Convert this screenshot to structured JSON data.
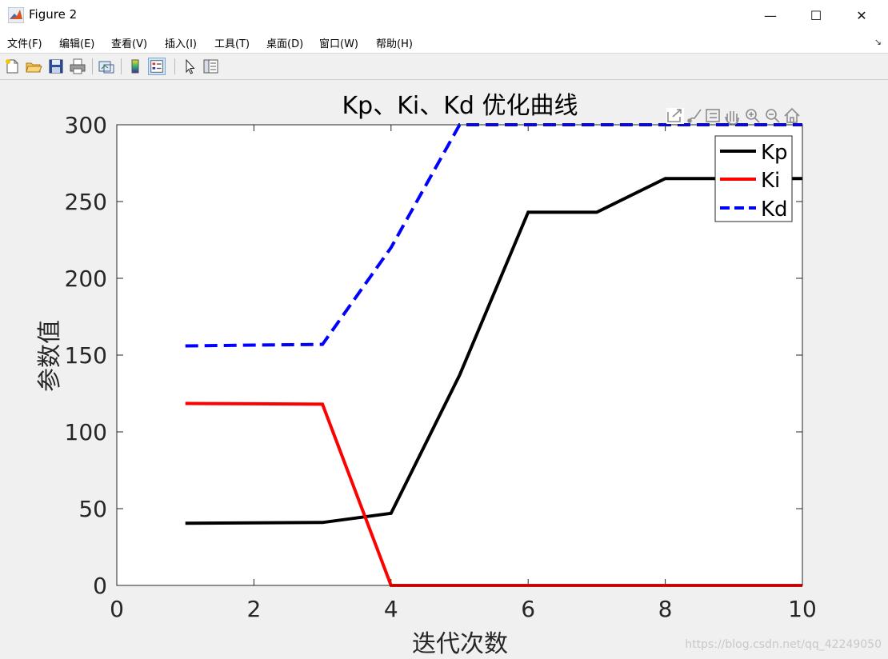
{
  "window": {
    "title": "Figure 2"
  },
  "window_controls": {
    "minimize": "—",
    "maximize": "☐",
    "close": "✕"
  },
  "menu": [
    "文件(F)",
    "编辑(E)",
    "查看(V)",
    "插入(I)",
    "工具(T)",
    "桌面(D)",
    "窗口(W)",
    "帮助(H)"
  ],
  "toolbar_icons": [
    "new-figure-icon",
    "open-file-icon",
    "save-icon",
    "print-icon",
    "link-plot-icon",
    "colorbar-icon",
    "legend-icon",
    "pointer-icon",
    "property-inspector-icon"
  ],
  "axes_toolbar_icons": [
    "export-icon",
    "brush-icon",
    "data-tips-icon",
    "pan-icon",
    "zoom-in-icon",
    "zoom-out-icon",
    "home-icon"
  ],
  "watermark": "https://blog.csdn.net/qq_42249050",
  "colors": {
    "kp": "#000000",
    "ki": "#ff0000",
    "kd": "#0000ff"
  },
  "chart_data": {
    "type": "line",
    "title": "Kp、Ki、Kd 优化曲线",
    "xlabel": "迭代次数",
    "ylabel": "参数值",
    "xlim": [
      0,
      10
    ],
    "ylim": [
      0,
      300
    ],
    "xticks": [
      "0",
      "2",
      "4",
      "6",
      "8",
      "10"
    ],
    "yticks": [
      "0",
      "50",
      "100",
      "150",
      "200",
      "250",
      "300"
    ],
    "legend_position": "top-right",
    "x": [
      1,
      2,
      3,
      4,
      5,
      6,
      7,
      8,
      9,
      10
    ],
    "series": [
      {
        "name": "Kp",
        "style": "solid",
        "values": [
          40.5,
          40.8,
          41,
          47,
          137,
          243,
          243,
          265,
          265,
          265
        ]
      },
      {
        "name": "Ki",
        "style": "solid",
        "values": [
          118.5,
          118.3,
          118,
          0,
          0,
          0,
          0,
          0,
          0,
          0
        ]
      },
      {
        "name": "Kd",
        "style": "dashed",
        "values": [
          156,
          156.5,
          157,
          220,
          300,
          300,
          300,
          300,
          300,
          300
        ]
      }
    ]
  }
}
